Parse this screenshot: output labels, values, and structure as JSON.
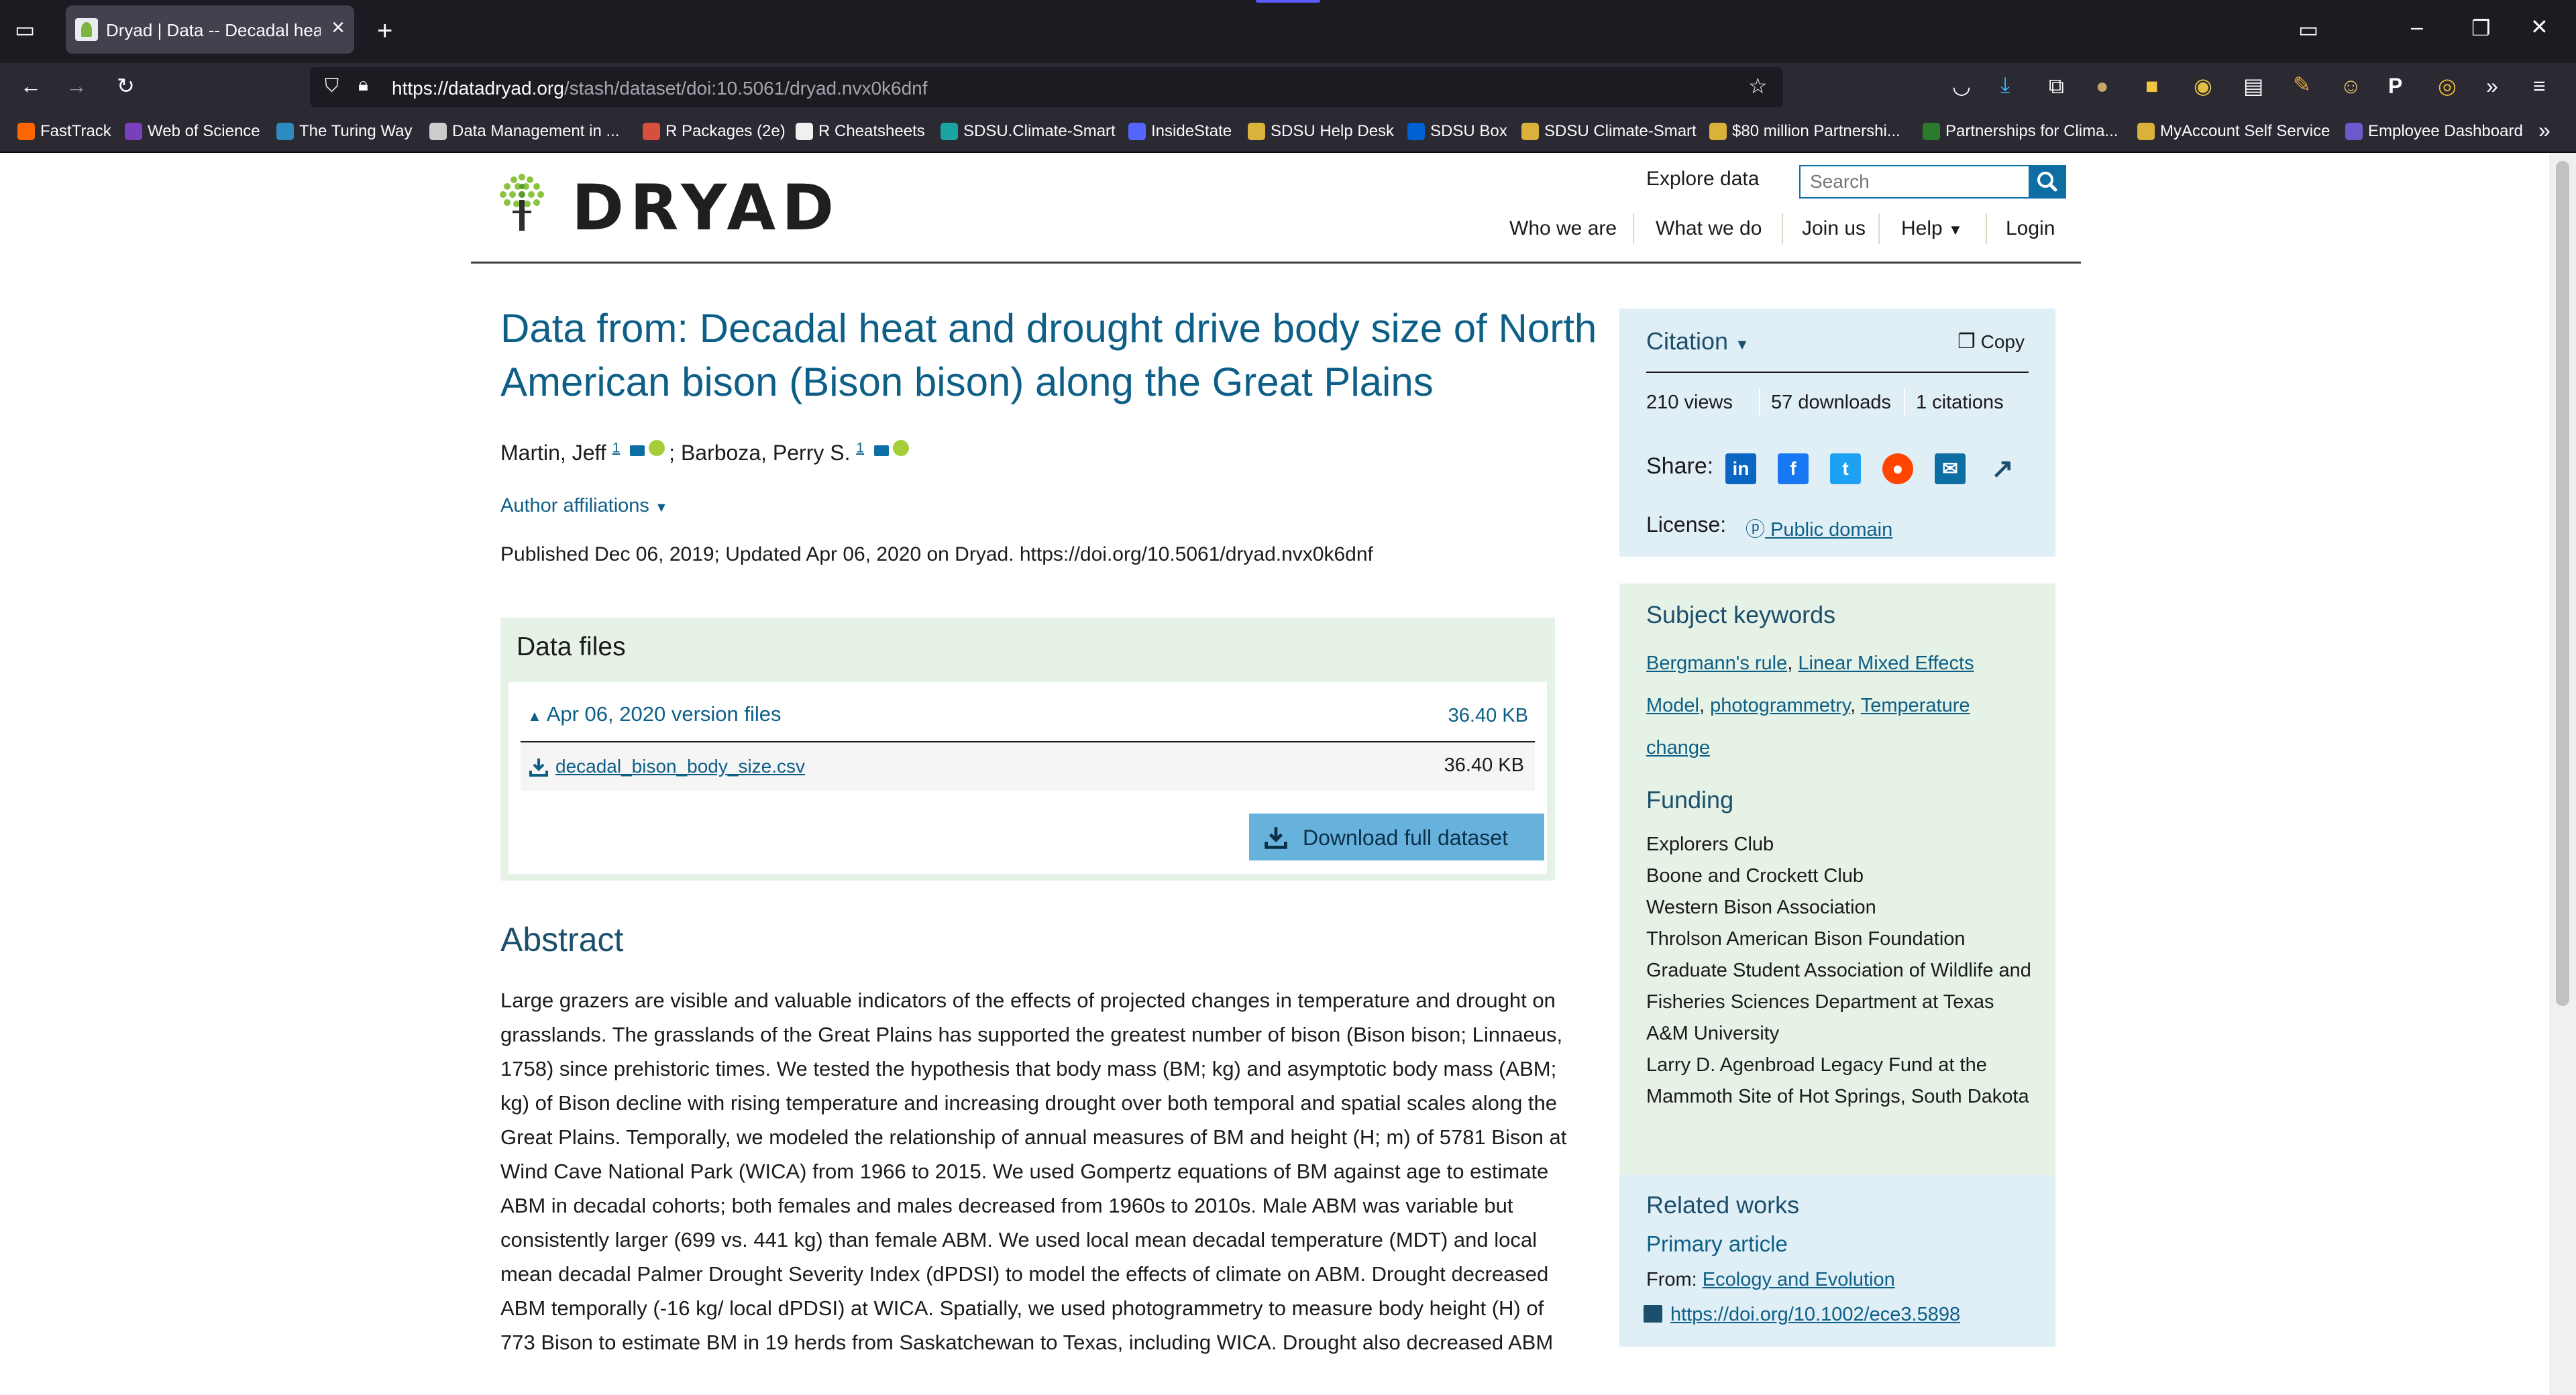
{
  "browser": {
    "tab_title": "Dryad | Data -- Decadal heat an",
    "url_host": "https://datadryad.org",
    "url_path": "/stash/dataset/doi:10.5061/dryad.nvx0k6dnf",
    "bookmarks": [
      {
        "label": "FastTrack",
        "color": "#ff6600"
      },
      {
        "label": "Web of Science",
        "color": "#7a3fbf"
      },
      {
        "label": "The Turing Way",
        "color": "#2e8bc0"
      },
      {
        "label": "Data Management in ...",
        "color": "#cccccc"
      },
      {
        "label": "R Packages (2e)",
        "color": "#d94f3d"
      },
      {
        "label": "R Cheatsheets",
        "color": "#f0f0f0"
      },
      {
        "label": "SDSU.Climate-Smart",
        "color": "#1aa3a3"
      },
      {
        "label": "InsideState",
        "color": "#5566ff"
      },
      {
        "label": "SDSU Help Desk",
        "color": "#d9b13b"
      },
      {
        "label": "SDSU Box",
        "color": "#0061d5"
      },
      {
        "label": "SDSU Climate-Smart",
        "color": "#d9b13b"
      },
      {
        "label": "$80 million Partnershi...",
        "color": "#d9b13b"
      },
      {
        "label": "Partnerships for Clima...",
        "color": "#2c7a2c"
      },
      {
        "label": "MyAccount Self Service",
        "color": "#d9b13b"
      },
      {
        "label": "Employee Dashboard",
        "color": "#6a5acd"
      }
    ]
  },
  "header": {
    "logo": "DRYAD",
    "explore": "Explore data",
    "search_placeholder": "Search",
    "nav": [
      "Who we are",
      "What we do",
      "Join us",
      "Help",
      "Login"
    ]
  },
  "dataset": {
    "title": "Data from: Decadal heat and drought drive body size of North American bison (Bison bison) along the Great Plains",
    "author1": "Martin, Jeff",
    "author2": "Barboza, Perry S.",
    "affiliation_sup": "1",
    "author_affiliations": "Author affiliations",
    "published": "Published Dec 06, 2019; Updated Apr 06, 2020 on Dryad. https://doi.org/10.5061/dryad.nvx0k6dnf"
  },
  "data_files": {
    "heading": "Data files",
    "version_label": "Apr 06, 2020 version files",
    "version_size": "36.40 KB",
    "file_name": "decadal_bison_body_size.csv",
    "file_size": "36.40 KB",
    "download_label": "Download full dataset"
  },
  "abstract": {
    "heading": "Abstract",
    "text": "Large grazers are visible and valuable indicators of the effects of projected changes in temperature and drought on grasslands. The grasslands of the Great Plains has supported the greatest number of bison (Bison bison; Linnaeus, 1758) since prehistoric times. We tested the hypothesis that body mass (BM; kg) and asymptotic body mass (ABM; kg) of Bison decline with rising temperature and increasing drought over both temporal and spatial scales along the Great Plains. Temporally, we modeled the relationship of annual measures of BM and height (H; m) of 5781 Bison at Wind Cave National Park (WICA) from 1966 to 2015. We used Gompertz equations of BM against age to estimate ABM in decadal cohorts; both females and males decreased from 1960s to 2010s. Male ABM was variable but consistently larger (699 vs. 441 kg) than female ABM. We used local mean decadal temperature (MDT) and local mean decadal Palmer Drought Severity Index (dPDSI) to model the effects of climate on ABM. Drought decreased ABM temporally (-16 kg/ local dPDSI) at WICA. Spatially, we used photogrammetry to measure body height (H) of 773 Bison to estimate BM in 19 herds from Saskatchewan to Texas, including WICA. Drought also decreased ABM"
  },
  "citation": {
    "label": "Citation",
    "copy": "Copy",
    "views": "210 views",
    "downloads": "57 downloads",
    "citations": "1 citations",
    "share_label": "Share:",
    "license_label": "License:",
    "license_value": "Public domain"
  },
  "keywords": {
    "heading": "Subject keywords",
    "items": [
      "Bergmann's rule",
      "Linear Mixed Effects Model",
      "photogrammetry",
      "Temperature change"
    ]
  },
  "funding": {
    "heading": "Funding",
    "items": [
      "Explorers Club",
      "Boone and Crockett Club",
      "Western Bison Association",
      "Throlson American Bison Foundation",
      "Graduate Student Association of Wildlife and Fisheries Sciences Department at Texas A&M University",
      "Larry D. Agenbroad Legacy Fund at the Mammoth Site of Hot Springs, South Dakota"
    ]
  },
  "related": {
    "heading": "Related works",
    "type": "Primary article",
    "from_label": "From:",
    "journal": "Ecology and Evolution",
    "doi": "https://doi.org/10.1002/ece3.5898"
  },
  "colors": {
    "brand_blue": "#0d5f87",
    "linkedin": "#0a66c2",
    "facebook": "#1877f2",
    "twitter": "#1da1f2",
    "reddit": "#ff4500",
    "email": "#0d6ea3"
  }
}
